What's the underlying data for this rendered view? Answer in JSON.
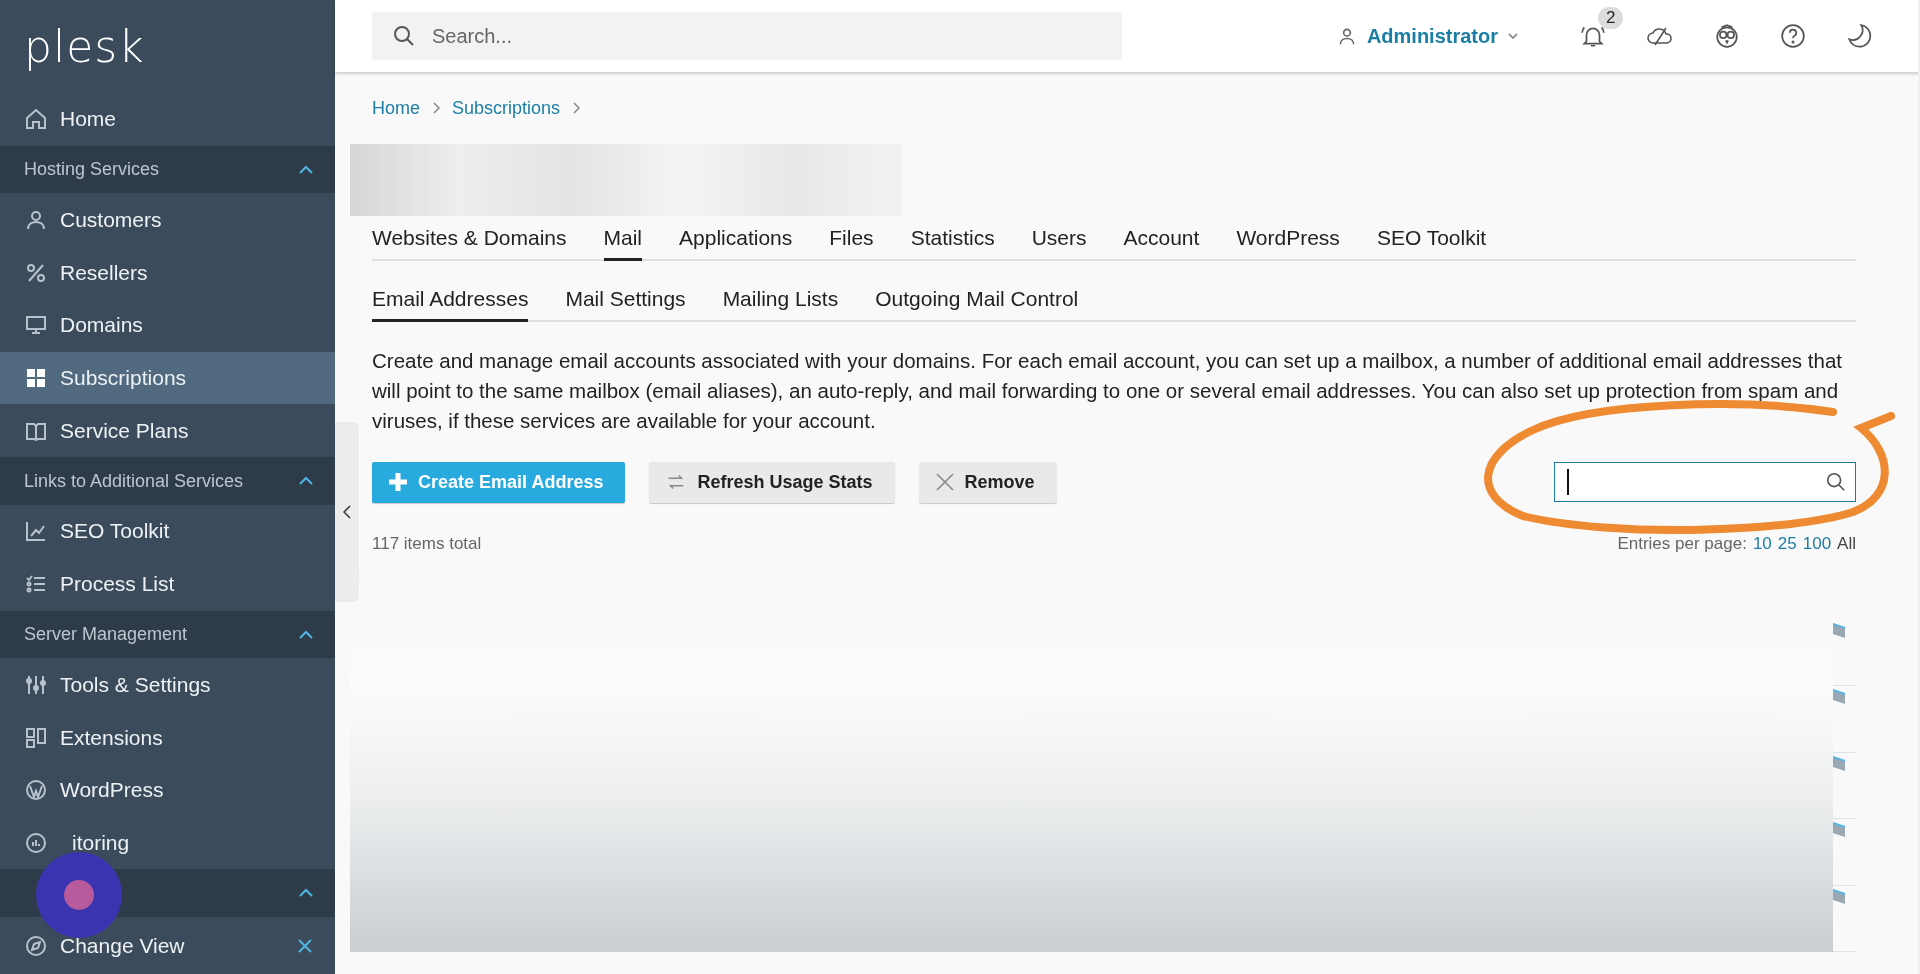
{
  "logo": "plesk",
  "sidebar": {
    "items": [
      {
        "kind": "link",
        "label": "Home",
        "selected": false
      },
      {
        "kind": "group",
        "label": "Hosting Services",
        "expanded": true
      },
      {
        "kind": "link",
        "label": "Customers",
        "selected": false
      },
      {
        "kind": "link",
        "label": "Resellers",
        "selected": false
      },
      {
        "kind": "link",
        "label": "Domains",
        "selected": false
      },
      {
        "kind": "link",
        "label": "Subscriptions",
        "selected": true
      },
      {
        "kind": "link",
        "label": "Service Plans",
        "selected": false
      },
      {
        "kind": "group",
        "label": "Links to Additional Services",
        "expanded": true
      },
      {
        "kind": "link",
        "label": "SEO Toolkit",
        "selected": false
      },
      {
        "kind": "link",
        "label": "Process List",
        "selected": false
      },
      {
        "kind": "group",
        "label": "Server Management",
        "expanded": true
      },
      {
        "kind": "link",
        "label": "Tools & Settings",
        "selected": false
      },
      {
        "kind": "link",
        "label": "Extensions",
        "selected": false
      },
      {
        "kind": "link",
        "label": "WordPress",
        "selected": false
      },
      {
        "kind": "covered",
        "label": "itoring",
        "selected": false
      },
      {
        "kind": "group",
        "expanded": true
      }
    ],
    "footer": {
      "label": "Change View"
    }
  },
  "topbar": {
    "search": {
      "placeholder": "Search..."
    },
    "user": "Administrator",
    "notifications": "2"
  },
  "breadcrumbs": [
    "Home",
    "Subscriptions"
  ],
  "tabs": [
    {
      "label": "Websites & Domains",
      "selected": false
    },
    {
      "label": "Mail",
      "selected": true
    },
    {
      "label": "Applications",
      "selected": false
    },
    {
      "label": "Files",
      "selected": false
    },
    {
      "label": "Statistics",
      "selected": false
    },
    {
      "label": "Users",
      "selected": false
    },
    {
      "label": "Account",
      "selected": false
    },
    {
      "label": "WordPress",
      "selected": false
    },
    {
      "label": "SEO Toolkit",
      "selected": false
    }
  ],
  "subtabs": [
    {
      "label": "Email Addresses",
      "selected": true
    },
    {
      "label": "Mail Settings",
      "selected": false
    },
    {
      "label": "Mailing Lists",
      "selected": false
    },
    {
      "label": "Outgoing Mail Control",
      "selected": false
    }
  ],
  "description": "Create and manage email accounts associated with your domains. For each email account, you can set up a mailbox, a number of additional email addresses that will point to the same mailbox (email aliases), an auto-reply, and mail forwarding to one or several email addresses. You can also set up protection from spam and viruses, if these services are available for your account.",
  "toolbar": {
    "buttons": [
      {
        "kind": "primary",
        "label": "Create Email Address"
      },
      {
        "kind": "refresh",
        "label": "Refresh Usage Stats"
      },
      {
        "kind": "remove",
        "label": "Remove"
      }
    ]
  },
  "list": {
    "total": "117 items total",
    "entries_label": "Entries per page:",
    "entries": [
      {
        "label": "10",
        "selected": false
      },
      {
        "label": "25",
        "selected": false
      },
      {
        "label": "100",
        "selected": false
      },
      {
        "label": "All",
        "selected": true
      }
    ]
  }
}
